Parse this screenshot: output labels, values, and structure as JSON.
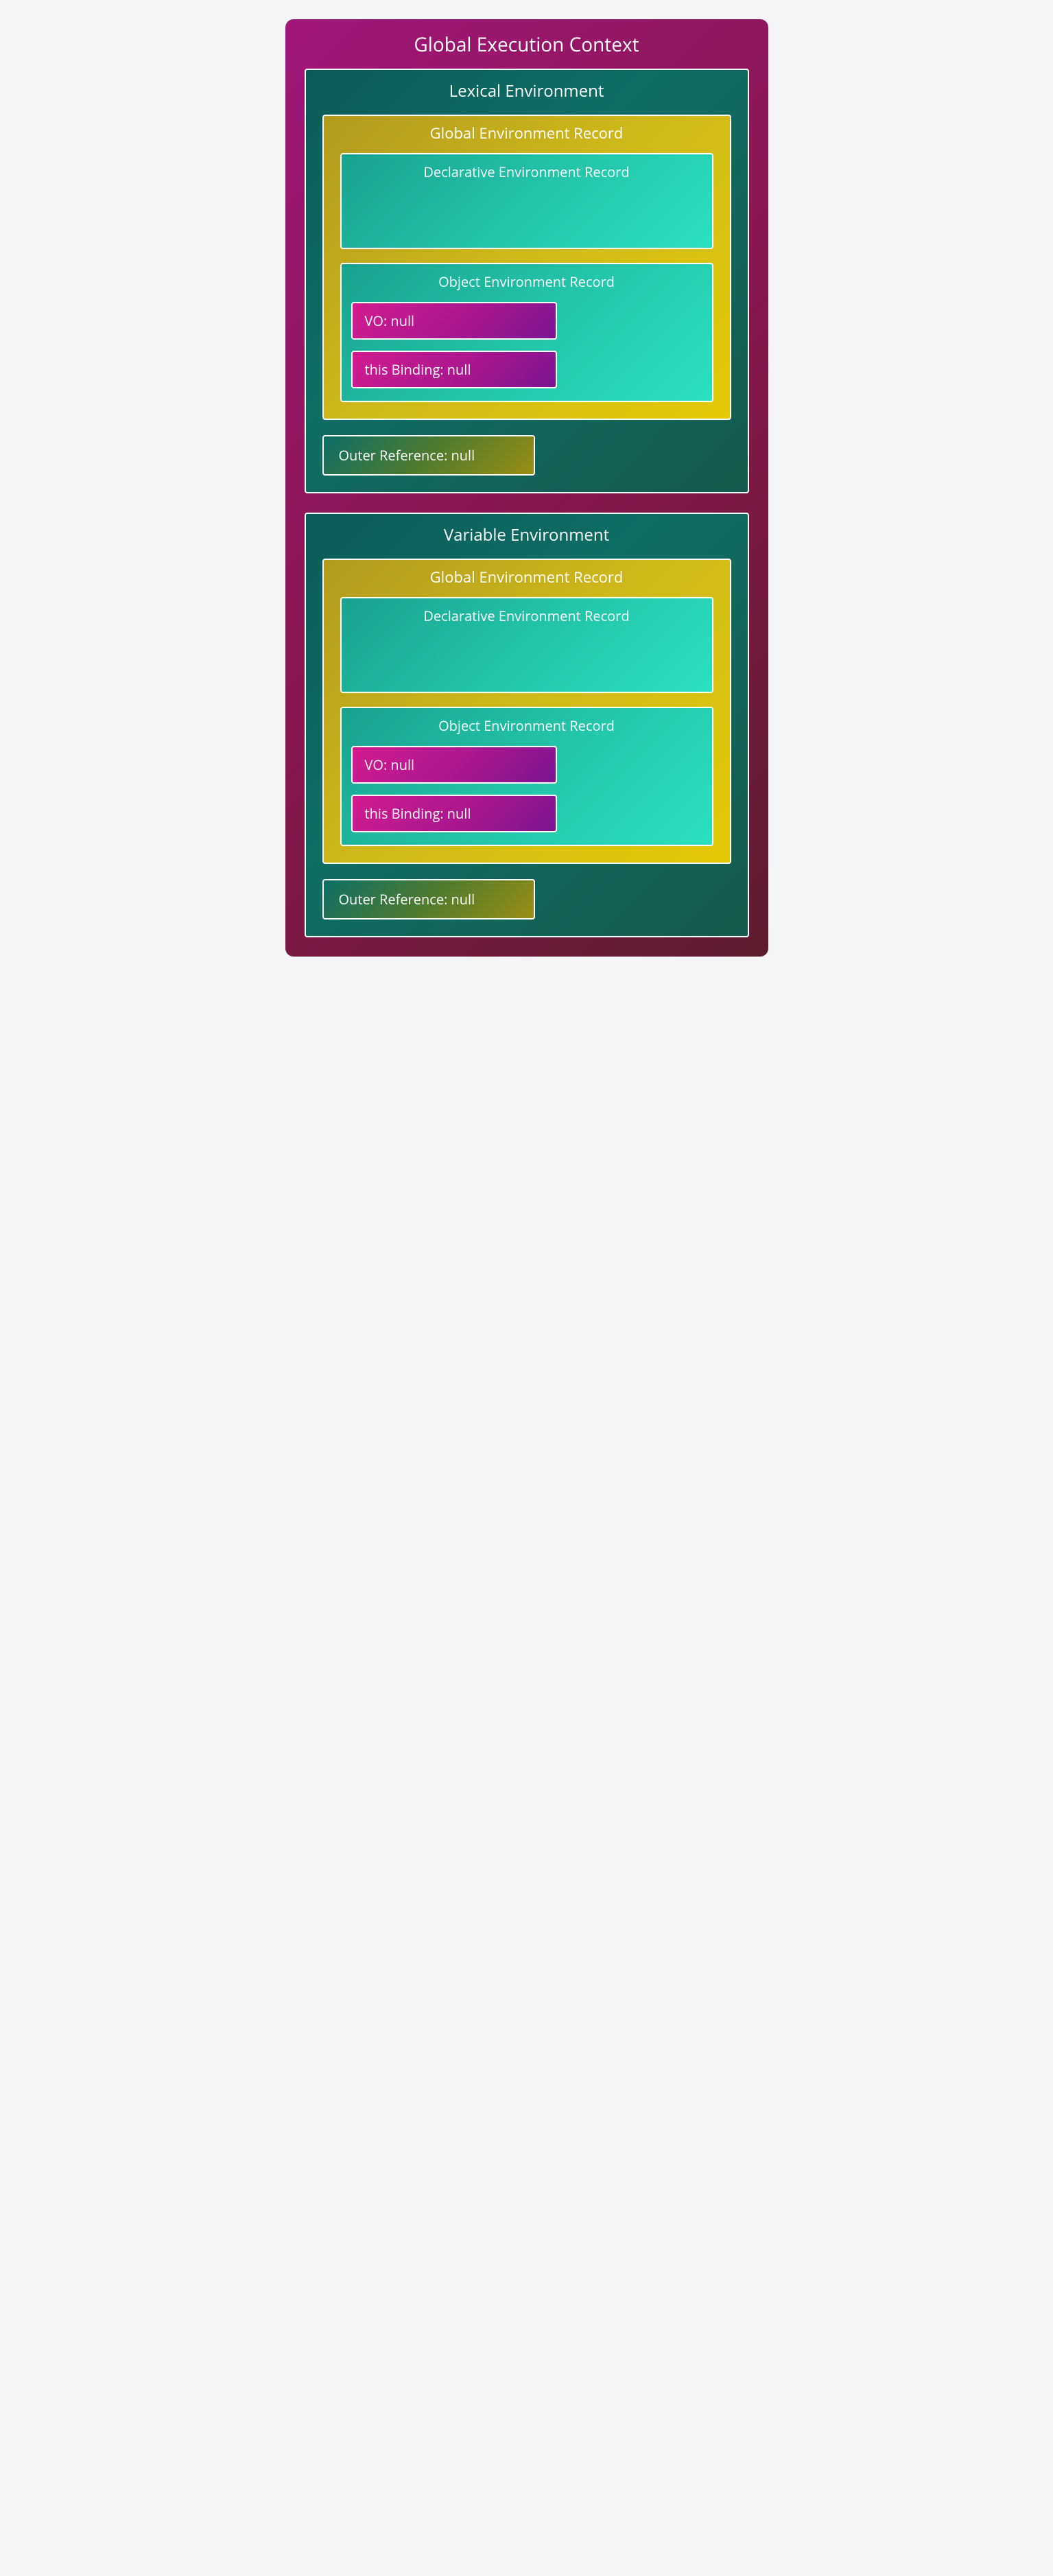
{
  "gec": {
    "title": "Global Execution Context",
    "environments": [
      {
        "title": "Lexical Environment",
        "record": {
          "title": "Global Environment Record",
          "declarative": {
            "title": "Declarative Environment Record"
          },
          "object": {
            "title": "Object Environment Record",
            "vo": "VO: null",
            "thisBinding": "this Binding: null"
          }
        },
        "outerRef": "Outer Reference: null"
      },
      {
        "title": "Variable Environment",
        "record": {
          "title": "Global Environment Record",
          "declarative": {
            "title": "Declarative Environment Record"
          },
          "object": {
            "title": "Object Environment Record",
            "vo": "VO: null",
            "thisBinding": "this Binding: null"
          }
        },
        "outerRef": "Outer Reference: null"
      }
    ]
  }
}
